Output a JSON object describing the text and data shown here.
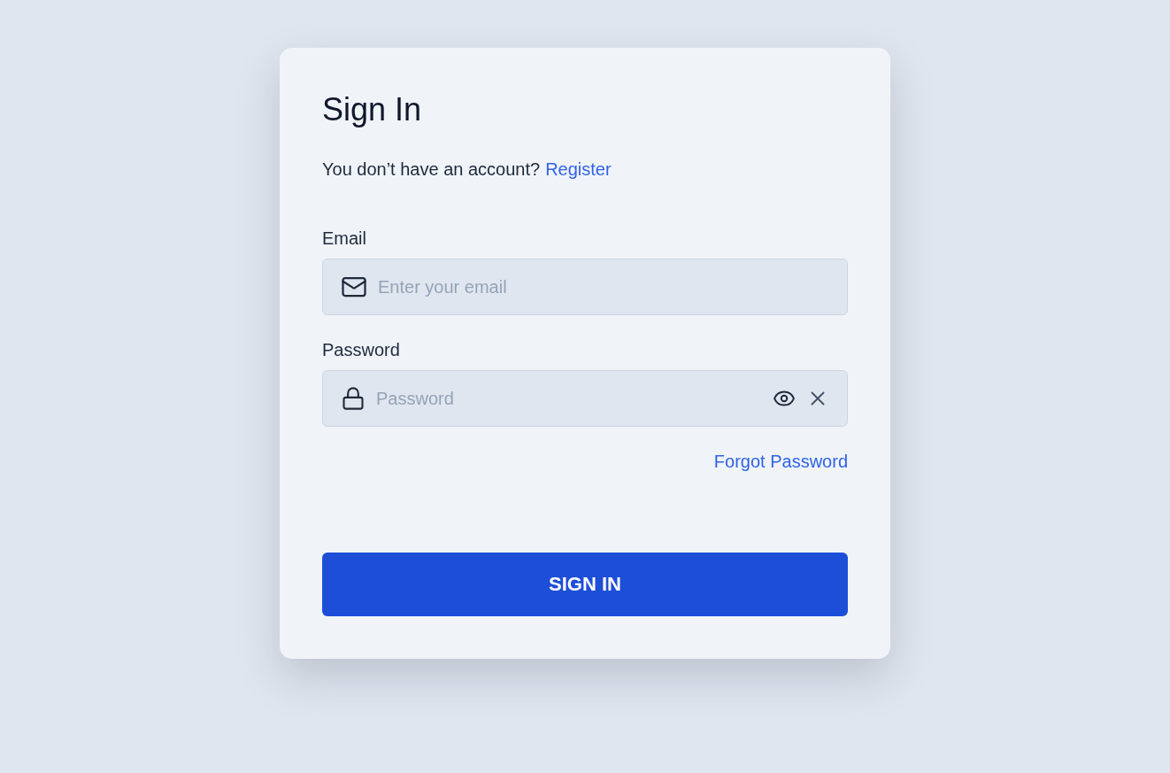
{
  "title": "Sign In",
  "prompt": {
    "text": "You don’t have an account?",
    "link": "Register"
  },
  "fields": [
    {
      "kind": "email",
      "label": "Email",
      "placeholder": "Enter your email"
    },
    {
      "kind": "password",
      "label": "Password",
      "placeholder": "Password"
    }
  ],
  "forgot_link": "Forgot Password",
  "submit": "SIGN IN"
}
